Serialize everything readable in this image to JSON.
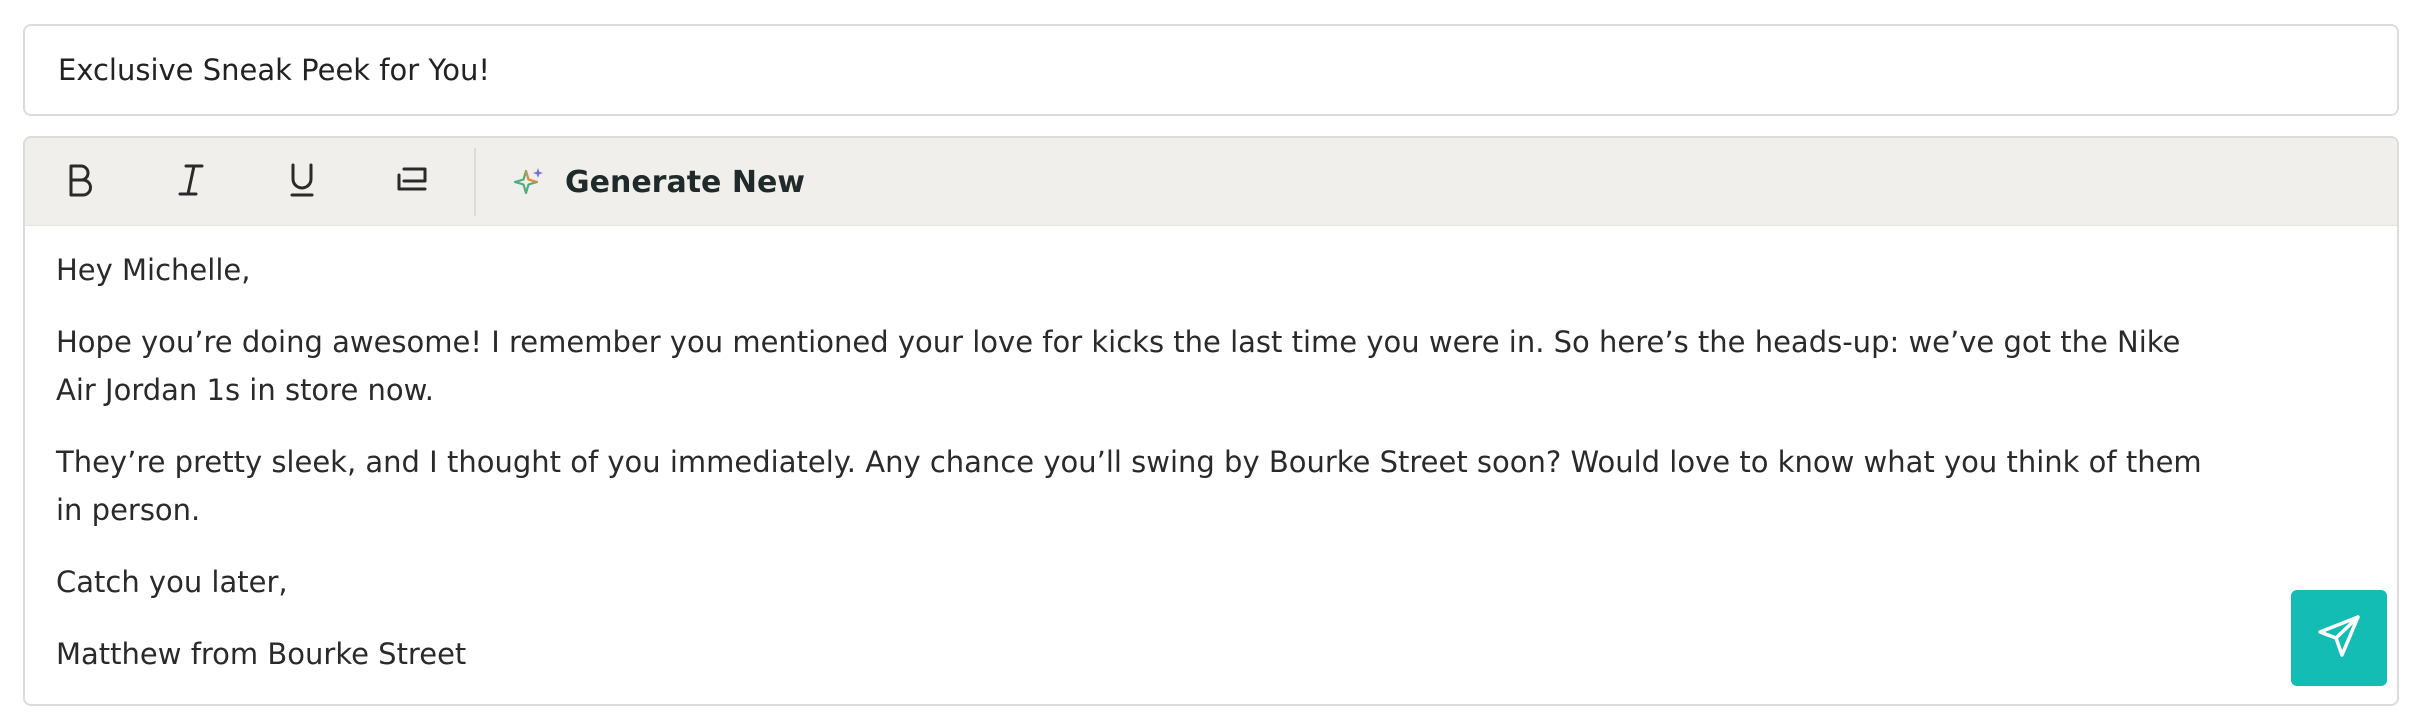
{
  "subject": {
    "value": "Exclusive Sneak Peek for You!"
  },
  "toolbar": {
    "bold_icon": "bold-icon",
    "italic_icon": "italic-icon",
    "underline_icon": "underline-icon",
    "wrap_icon": "text-wrap-icon",
    "generate_icon": "sparkle-icon",
    "generate_label": "Generate New"
  },
  "message": {
    "greeting": "Hey Michelle,",
    "paragraph_1": "Hope you’re doing awesome! I remember you mentioned your love for kicks the last time you were in. So here’s the heads-up: we’ve got the Nike Air Jordan 1s in store now.",
    "paragraph_2": "They’re pretty sleek, and I thought of you immediately. Any chance you’ll swing by Bourke Street soon? Would love to know what you think of them in person.",
    "closing": "Catch you later,",
    "signature": "Matthew from Bourke Street"
  },
  "send_button": {
    "icon": "send-icon"
  },
  "colors": {
    "accent": "#14bdb4",
    "toolbar_bg": "#f0efeb",
    "border": "#dcdcda"
  }
}
